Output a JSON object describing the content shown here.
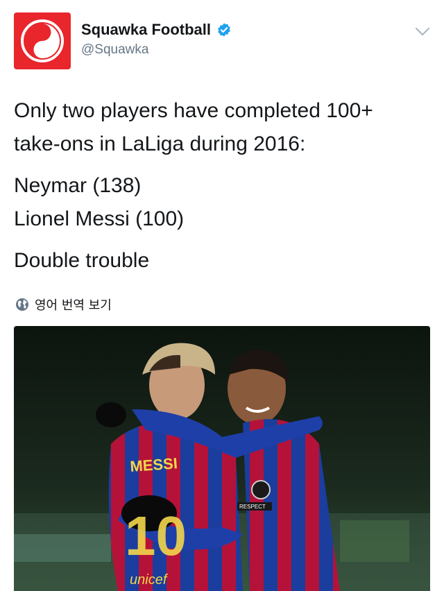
{
  "tweet": {
    "author": {
      "display_name": "Squawka Football",
      "handle": "@Squawka",
      "verified": true,
      "avatar_color": "#e8262c"
    },
    "lines": [
      "Only two players have completed 100+",
      "take-ons in LaLiga during 2016:",
      "Neymar (138)",
      "Lionel Messi (100)",
      "Double trouble"
    ],
    "translate_label": "영어 번역 보기",
    "photo": {
      "jersey_name": "MESSI",
      "jersey_number": "10",
      "sponsor": "unicef",
      "patch": "RESPECT"
    }
  },
  "colors": {
    "verified_blue": "#1da1f2",
    "text": "#14171a",
    "secondary": "#657786"
  }
}
